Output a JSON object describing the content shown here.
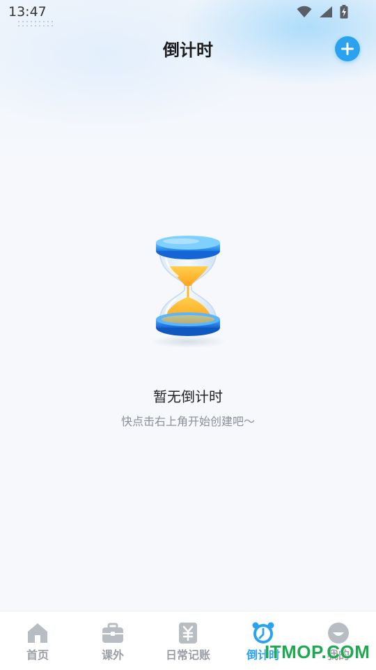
{
  "status_bar": {
    "time": "13:47",
    "icons": [
      "wifi-icon",
      "cellular-signal-icon",
      "battery-charging-icon"
    ]
  },
  "header": {
    "title": "倒计时",
    "add_icon": "plus-icon"
  },
  "empty_state": {
    "illustration": "hourglass-illustration",
    "title": "暂无倒计时",
    "subtitle": "快点击右上角开始创建吧～"
  },
  "tab_bar": {
    "tabs": [
      {
        "label": "首页",
        "icon": "home-icon",
        "active": false
      },
      {
        "label": "课外",
        "icon": "briefcase-icon",
        "active": false
      },
      {
        "label": "日常记账",
        "icon": "yen-ledger-icon",
        "active": false
      },
      {
        "label": "倒计时",
        "icon": "alarm-clock-icon",
        "active": true
      },
      {
        "label": "我的",
        "icon": "profile-icon",
        "active": false
      }
    ]
  },
  "watermark": {
    "text": "ITMOP.COM"
  },
  "colors": {
    "accent": "#2aa2f0",
    "tab_inactive": "#9a9ea6",
    "sand": "#ffb72a",
    "watermark": "#1ea84f"
  }
}
